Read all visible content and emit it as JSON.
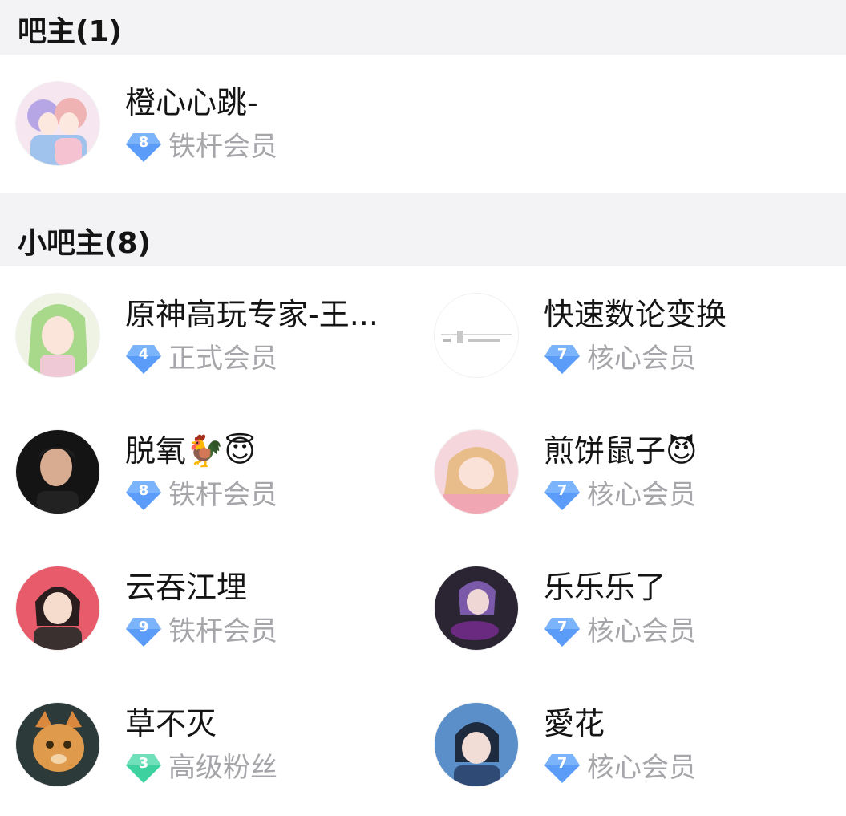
{
  "owner_section": {
    "title": "吧主(1)"
  },
  "sub_owner_section": {
    "title": "小吧主(8)"
  },
  "owner": {
    "name": "橙心心跳-",
    "level": "8",
    "rank": "铁杆会员",
    "badge_color": "#5a9cf8",
    "avatar": "anime-girls-avatar"
  },
  "sub_owners": [
    {
      "name": "原神高玩专家-王...",
      "level": "4",
      "rank": "正式会员",
      "badge_color": "#5a9cf8",
      "avatar": "green-hair-anime-avatar"
    },
    {
      "name": "快速数论变换",
      "level": "7",
      "rank": "核心会员",
      "badge_color": "#5a9cf8",
      "avatar": "math-formula-avatar"
    },
    {
      "name": "脱氧🐓😇",
      "level": "8",
      "rank": "铁杆会员",
      "badge_color": "#5a9cf8",
      "avatar": "man-portrait-avatar"
    },
    {
      "name": "煎饼鼠子😈",
      "level": "7",
      "rank": "核心会员",
      "badge_color": "#5a9cf8",
      "avatar": "pink-anime-avatar"
    },
    {
      "name": "云吞江埋",
      "level": "9",
      "rank": "铁杆会员",
      "badge_color": "#5a9cf8",
      "avatar": "red-bg-anime-avatar"
    },
    {
      "name": "乐乐乐了",
      "level": "7",
      "rank": "核心会员",
      "badge_color": "#5a9cf8",
      "avatar": "guitar-anime-avatar"
    },
    {
      "name": "草不灭",
      "level": "3",
      "rank": "高级粉丝",
      "badge_color": "#3ed1a0",
      "avatar": "cat-avatar"
    },
    {
      "name": "愛花",
      "level": "7",
      "rank": "核心会员",
      "badge_color": "#5a9cf8",
      "avatar": "blue-anime-avatar"
    }
  ]
}
